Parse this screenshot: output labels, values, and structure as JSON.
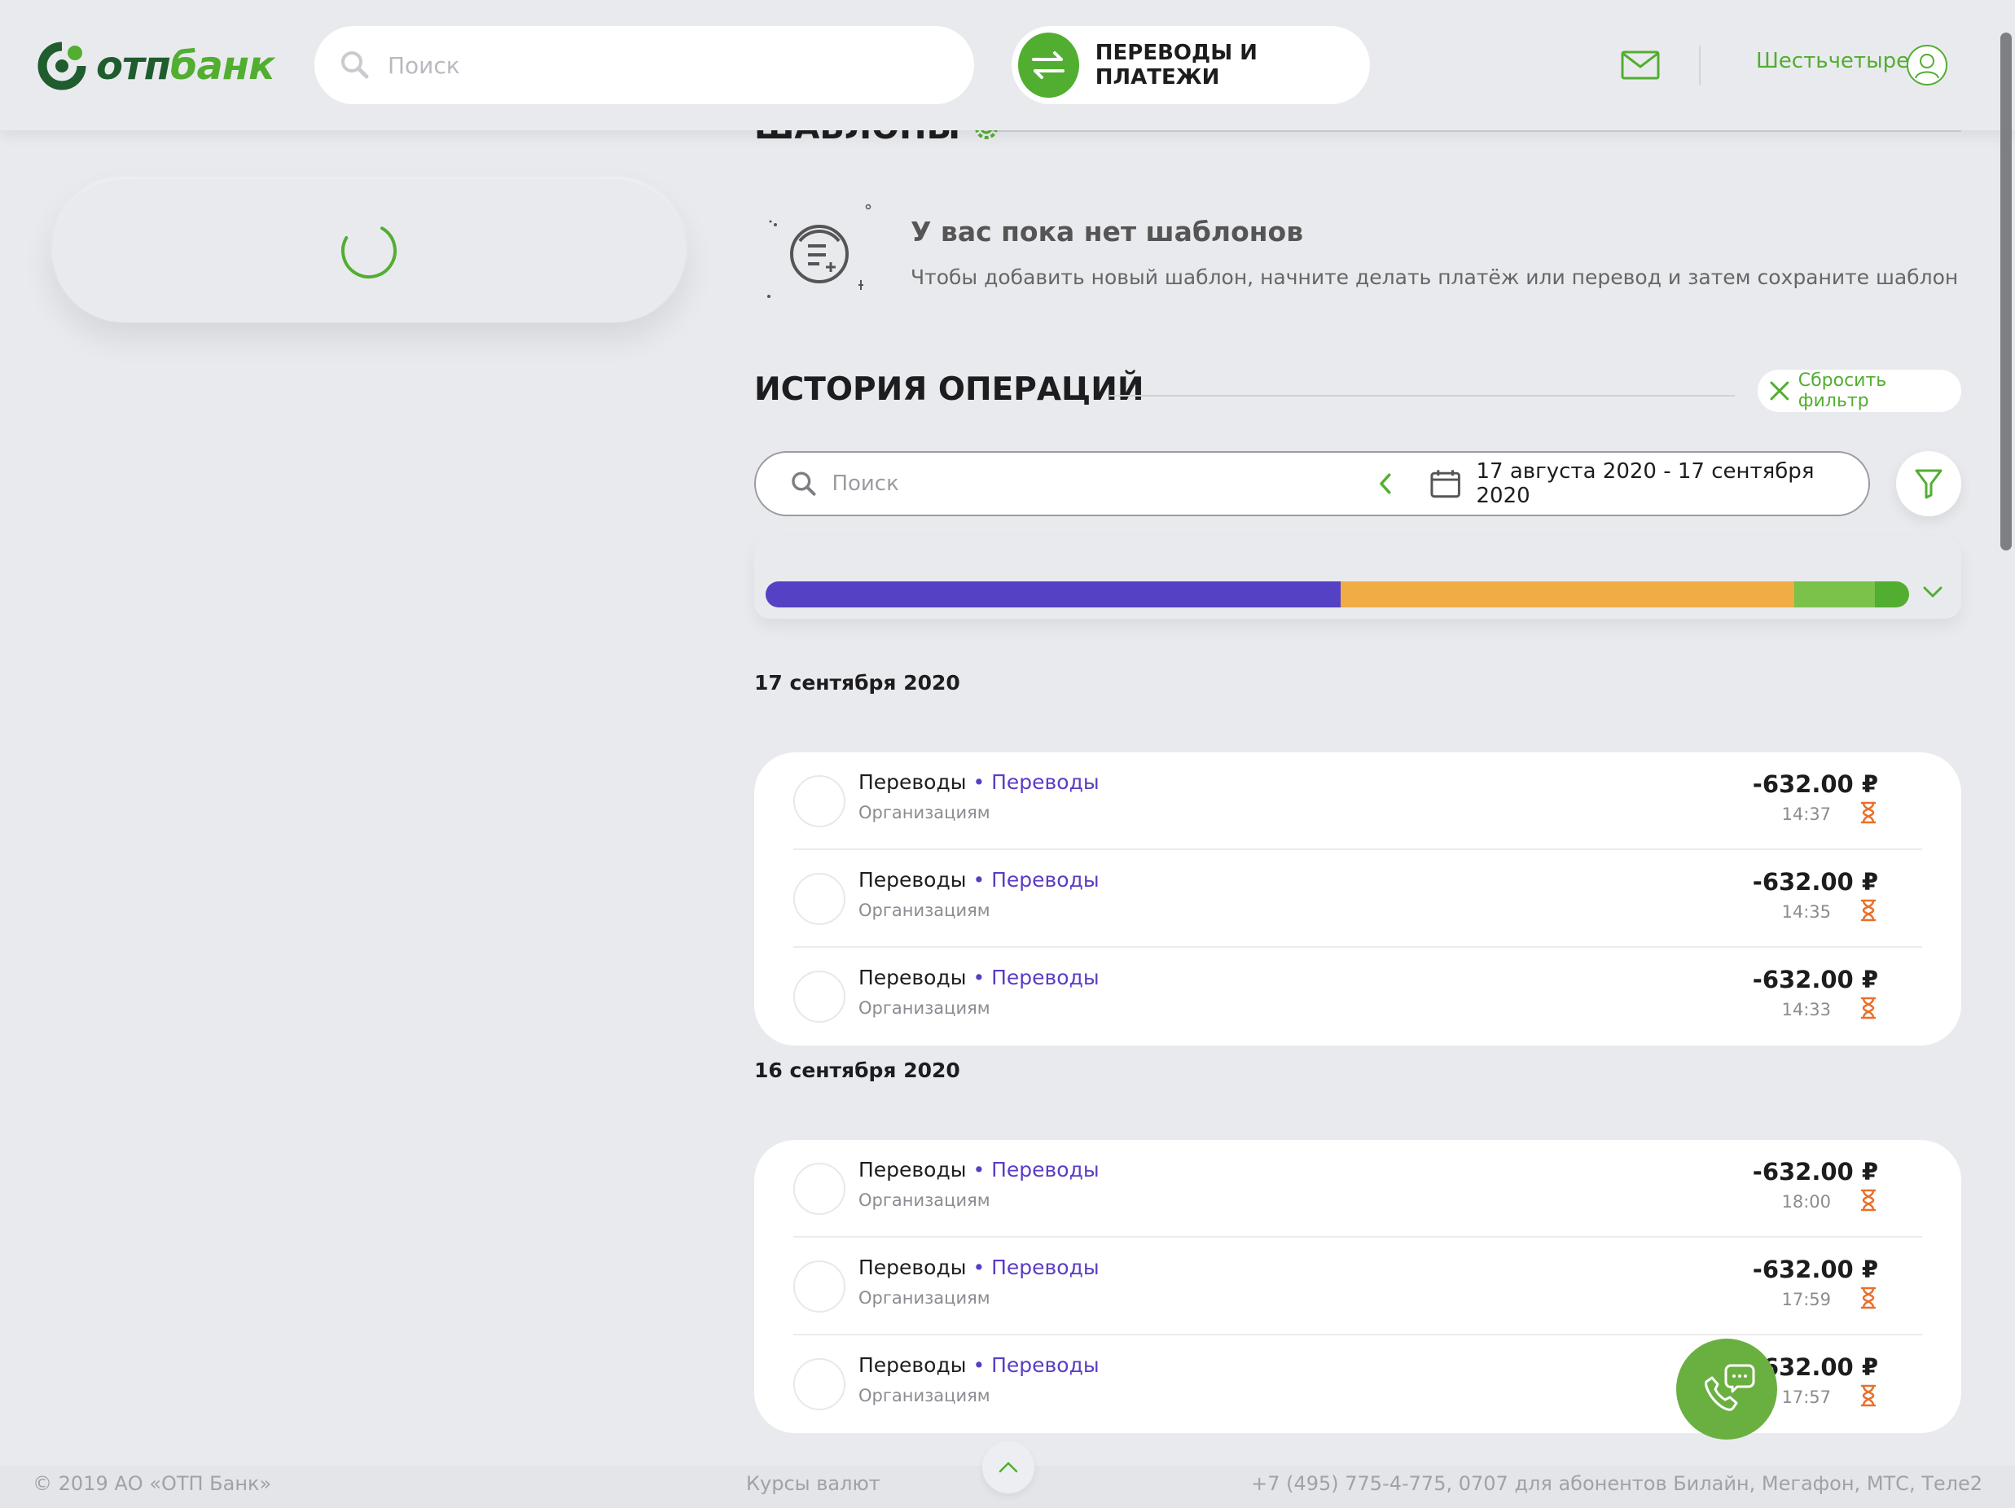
{
  "header": {
    "logo_text_1": "отп",
    "logo_text_2": "банк",
    "search_placeholder": "Поиск",
    "transfers_label": "ПЕРЕВОДЫ И ПЛАТЕЖИ",
    "user_name": "Шестьчетыре"
  },
  "templates": {
    "title": "ШАБЛОНЫ",
    "empty_title": "У вас пока нет шаблонов",
    "empty_text": "Чтобы добавить новый шаблон, начните делать платёж или перевод и затем сохраните шаблон"
  },
  "history": {
    "title": "ИСТОРИЯ ОПЕРАЦИЙ",
    "reset_filter": "Сбросить фильтр",
    "search_placeholder": "Поиск",
    "date_range": "17 августа 2020 - 17 сентября 2020",
    "spend_bar": [
      {
        "fraction": 0.5025,
        "color": "#5541c4"
      },
      {
        "fraction": 0.397,
        "color": "#f0ac45"
      },
      {
        "fraction": 0.0708,
        "color": "#7ac24a"
      },
      {
        "fraction": 0.0297,
        "color": "#52ae30"
      }
    ],
    "groups": [
      {
        "date": "17 сентября 2020",
        "operations": [
          {
            "title": "Переводы",
            "category": "• Переводы",
            "subtitle": "Организациям",
            "amount": "-632.00 ₽",
            "time": "14:37"
          },
          {
            "title": "Переводы",
            "category": "• Переводы",
            "subtitle": "Организациям",
            "amount": "-632.00 ₽",
            "time": "14:35"
          },
          {
            "title": "Переводы",
            "category": "• Переводы",
            "subtitle": "Организациям",
            "amount": "-632.00 ₽",
            "time": "14:33"
          }
        ]
      },
      {
        "date": "16 сентября 2020",
        "operations": [
          {
            "title": "Переводы",
            "category": "• Переводы",
            "subtitle": "Организациям",
            "amount": "-632.00 ₽",
            "time": "18:00"
          },
          {
            "title": "Переводы",
            "category": "• Переводы",
            "subtitle": "Организациям",
            "amount": "-632.00 ₽",
            "time": "17:59"
          },
          {
            "title": "Переводы",
            "category": "• Переводы",
            "subtitle": "Организациям",
            "amount": "-632.00 ₽",
            "time": "17:57"
          }
        ]
      }
    ]
  },
  "footer": {
    "copyright": "© 2019 АО «ОТП Банк»",
    "rates": "Курсы валют",
    "phone": "+7 (495) 775-4-775,  0707 для абонентов Билайн, Мегафон, МТС, Теле2"
  },
  "colors": {
    "brand_green": "#52ae30",
    "dark_green": "#1f5c2e",
    "category_purple": "#5b3cc4",
    "pending_orange": "#e8702a"
  },
  "icons": {
    "search": "search-icon",
    "transfers": "arrows-swap-icon",
    "mail": "mail-icon",
    "avatar": "user-avatar-icon",
    "gear": "gear-icon",
    "calendar": "calendar-icon",
    "filter": "filter-icon",
    "pending": "hourglass-icon",
    "call": "phone-chat-icon"
  }
}
